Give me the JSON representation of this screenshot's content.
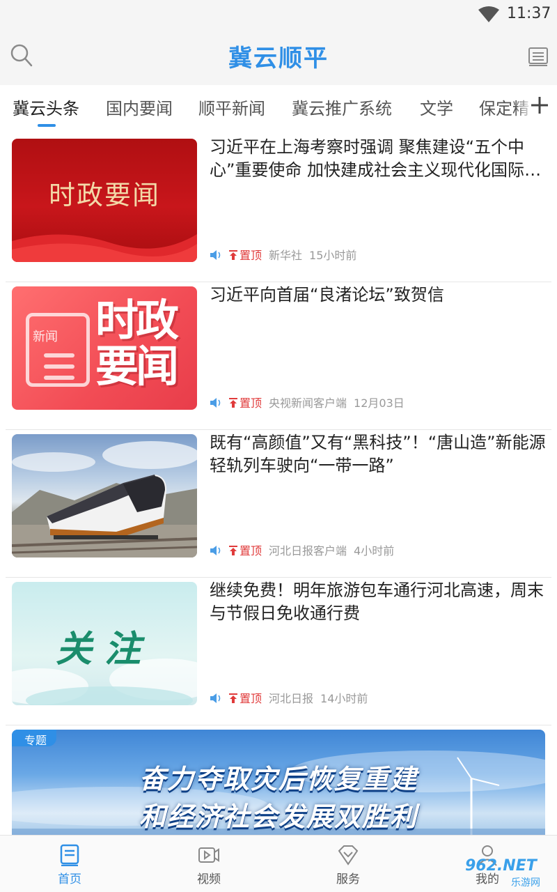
{
  "status_bar": {
    "time": "11:37"
  },
  "header": {
    "title": "冀云顺平"
  },
  "tabs": [
    {
      "label": "冀云头条",
      "active": true
    },
    {
      "label": "国内要闻",
      "active": false
    },
    {
      "label": "顺平新闻",
      "active": false
    },
    {
      "label": "冀云推广系统",
      "active": false
    },
    {
      "label": "文学",
      "active": false
    },
    {
      "label": "保定精",
      "active": false
    }
  ],
  "news": [
    {
      "title": "习近平在上海考察时强调 聚焦建设“五个中心”重要使命 加快建成社会主义现代化国际大都市",
      "thumb_text": "时政要闻",
      "pin_label": "置顶",
      "source": "新华社",
      "time": "15小时前"
    },
    {
      "title": "习近平向首届“良渚论坛”致贺信",
      "thumb_badge": "新闻",
      "thumb_text_1": "时政",
      "thumb_text_2": "要闻",
      "pin_label": "置顶",
      "source": "央视新闻客户端",
      "time": "12月03日"
    },
    {
      "title": "既有“高颜值”又有“黑科技”！“唐山造”新能源轻轨列车驶向“一带一路”",
      "pin_label": "置顶",
      "source": "河北日报客户端",
      "time": "4小时前"
    },
    {
      "title": "继续免费！明年旅游包车通行河北高速，周末与节假日免收通行费",
      "thumb_text": "关注",
      "pin_label": "置顶",
      "source": "河北日报",
      "time": "14小时前"
    }
  ],
  "banner": {
    "tag": "专题",
    "line1": "奋力夺取灾后恢复重建",
    "line2": "和经济社会发展双胜利"
  },
  "bottom_nav": [
    {
      "label": "首页",
      "icon": "home-doc-icon",
      "active": true
    },
    {
      "label": "视频",
      "icon": "video-icon",
      "active": false
    },
    {
      "label": "服务",
      "icon": "service-icon",
      "active": false
    },
    {
      "label": "我的",
      "icon": "user-icon",
      "active": false
    }
  ],
  "watermark": {
    "text": "962.NET",
    "sub": "乐游网"
  },
  "colors": {
    "accent": "#2f8fe6",
    "pin": "#e03a3a",
    "meta": "#999999"
  }
}
